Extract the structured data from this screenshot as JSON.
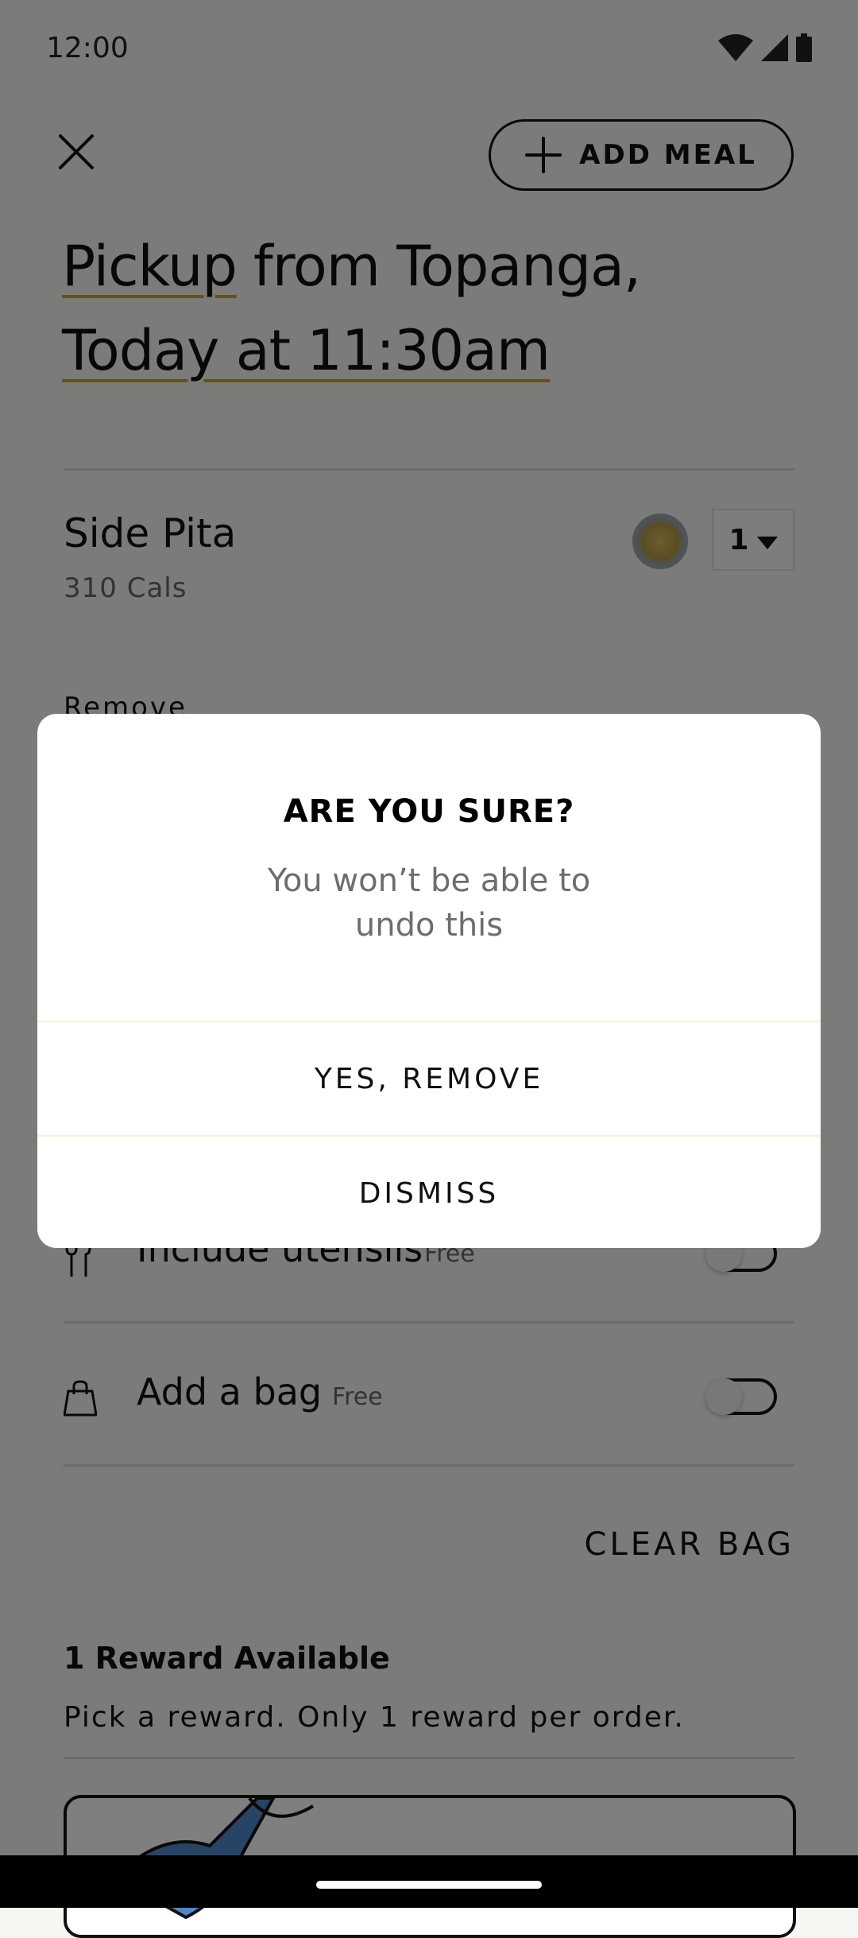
{
  "status_bar": {
    "time": "12:00"
  },
  "header": {
    "add_meal_label": "ADD MEAL"
  },
  "pickup": {
    "line1_link": "Pickup",
    "line1_rest": " from Topanga,",
    "line2_link": "Today at 11:30am"
  },
  "cart_item": {
    "name": "Side Pita",
    "calories": "310 Cals",
    "quantity": "1",
    "remove_label": "Remove"
  },
  "options": {
    "utensils_label": "Include utensils",
    "utensils_price": "Free",
    "bag_label": "Add a bag",
    "bag_price": "Free"
  },
  "clear_bag_label": "CLEAR BAG",
  "rewards": {
    "title": "1 Reward Available",
    "subtitle": "Pick a reward. Only 1 reward per order."
  },
  "dialog": {
    "title": "ARE YOU SURE?",
    "message": "You won’t be able to undo this",
    "confirm_label": "YES, REMOVE",
    "dismiss_label": "DISMISS"
  },
  "colors": {
    "accent_underline": "#c7a13d",
    "overlay": "rgba(0,0,0,0.5)"
  },
  "icons": [
    "wifi-icon",
    "signal-icon",
    "battery-icon",
    "close-icon",
    "plus-icon",
    "chevron-down-icon",
    "utensils-icon",
    "bag-icon"
  ]
}
